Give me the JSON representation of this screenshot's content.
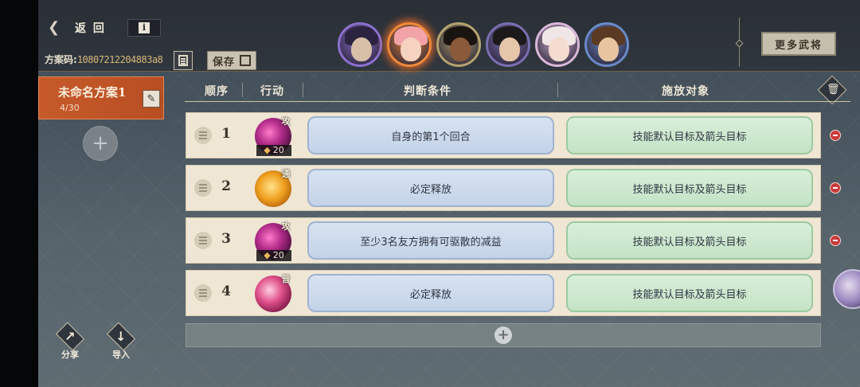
{
  "header": {
    "back_label": "返 回",
    "info_label": "i",
    "plan_code_label": "方案码:",
    "plan_code_value": "10807212204883a8",
    "save_label": "保存",
    "more_generals_label": "更多武将"
  },
  "portraits": [
    {
      "name": "hero-1",
      "skin": "#d8c0a8",
      "hair": "#2b2340",
      "ring": "#8c6fd0",
      "selected": false
    },
    {
      "name": "hero-2",
      "skin": "#f6d2c0",
      "hair": "#f2a3a8",
      "ring": "#f08a3a",
      "selected": true
    },
    {
      "name": "hero-3",
      "skin": "#8a5a3a",
      "hair": "#1a1410",
      "ring": "#b3a36e",
      "selected": false
    },
    {
      "name": "hero-4",
      "skin": "#e6c6a8",
      "hair": "#1c1a1a",
      "ring": "#7a6fb0",
      "selected": false
    },
    {
      "name": "hero-5",
      "skin": "#f4dcd0",
      "hair": "#f0e6e6",
      "ring": "#d8b8d8",
      "selected": false
    },
    {
      "name": "hero-6",
      "skin": "#e8c4a0",
      "hair": "#5a3a22",
      "ring": "#6a8ac8",
      "selected": false
    }
  ],
  "plan": {
    "name": "未命名方案1",
    "count": "4/30"
  },
  "columns": {
    "order": "顺序",
    "action": "行动",
    "condition": "判断条件",
    "target": "施放对象"
  },
  "rows": [
    {
      "num": "1",
      "skill": "purple",
      "mark": "攻",
      "cost": "20",
      "condition": "自身的第1个回合",
      "target": "技能默认目标及箭头目标",
      "removable": true
    },
    {
      "num": "2",
      "skill": "gold",
      "mark": "通",
      "cost": "",
      "condition": "必定释放",
      "target": "技能默认目标及箭头目标",
      "removable": true
    },
    {
      "num": "3",
      "skill": "purple",
      "mark": "攻",
      "cost": "20",
      "condition": "至少3名友方拥有可驱散的减益",
      "target": "技能默认目标及箭头目标",
      "removable": true
    },
    {
      "num": "4",
      "skill": "pink",
      "mark": "普",
      "cost": "",
      "condition": "必定释放",
      "target": "技能默认目标及箭头目标",
      "removable": false
    }
  ],
  "tools": {
    "share_label": "分享",
    "import_label": "导入"
  }
}
